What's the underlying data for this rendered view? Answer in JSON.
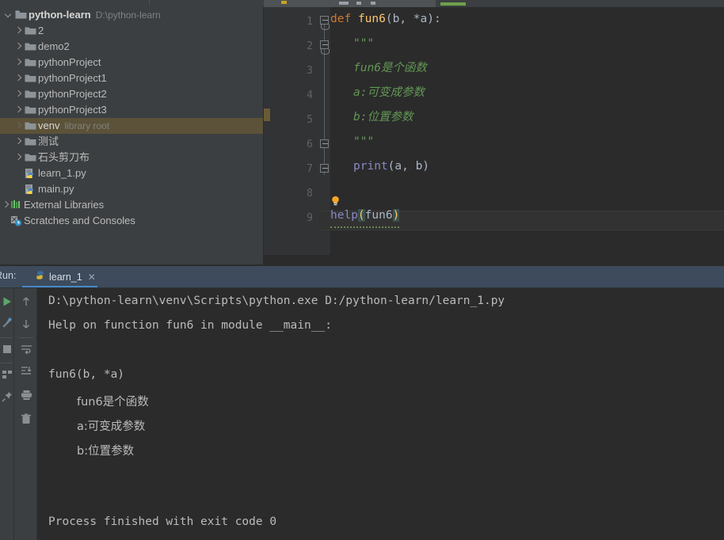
{
  "window": {
    "title": "python-learn"
  },
  "sidebar": {
    "root": {
      "label": "python-learn",
      "path": "D:\\python-learn"
    },
    "items": [
      {
        "label": "2",
        "type": "folder",
        "expandable": true
      },
      {
        "label": "demo2",
        "type": "folder",
        "expandable": true
      },
      {
        "label": "pythonProject",
        "type": "folder",
        "expandable": true
      },
      {
        "label": "pythonProject1",
        "type": "folder",
        "expandable": true
      },
      {
        "label": "pythonProject2",
        "type": "folder",
        "expandable": true
      },
      {
        "label": "pythonProject3",
        "type": "folder",
        "expandable": true
      },
      {
        "label": "venv",
        "type": "folder",
        "expandable": true,
        "badge": "library root",
        "selected": true
      },
      {
        "label": "测试",
        "type": "folder",
        "expandable": true
      },
      {
        "label": "石头剪刀布",
        "type": "folder",
        "expandable": true
      },
      {
        "label": "learn_1.py",
        "type": "python-file",
        "expandable": false
      },
      {
        "label": "main.py",
        "type": "python-file",
        "expandable": false
      }
    ],
    "external_libraries": "External Libraries",
    "scratches": "Scratches and Consoles"
  },
  "editor": {
    "line_numbers": [
      "1",
      "2",
      "3",
      "4",
      "5",
      "6",
      "7",
      "8",
      "9"
    ],
    "lines": [
      {
        "n": 1,
        "tokens": [
          {
            "t": "def",
            "c": "kw"
          },
          {
            "t": " ",
            "c": "punc"
          },
          {
            "t": "fun6",
            "c": "fn"
          },
          {
            "t": "(b, *a):",
            "c": "punc"
          }
        ]
      },
      {
        "n": 2,
        "tokens": [
          {
            "t": "    \"\"\"",
            "c": "doc"
          }
        ]
      },
      {
        "n": 3,
        "tokens": [
          {
            "t": "    fun6是个函数",
            "c": "doc"
          }
        ]
      },
      {
        "n": 4,
        "tokens": [
          {
            "t": "    a:可变成参数",
            "c": "doc"
          }
        ]
      },
      {
        "n": 5,
        "tokens": [
          {
            "t": "    b:位置参数",
            "c": "doc"
          }
        ]
      },
      {
        "n": 6,
        "tokens": [
          {
            "t": "    \"\"\"",
            "c": "doc"
          }
        ]
      },
      {
        "n": 7,
        "tokens": [
          {
            "t": "    ",
            "c": "punc"
          },
          {
            "t": "print",
            "c": "bi"
          },
          {
            "t": "(a, b)",
            "c": "punc"
          }
        ]
      },
      {
        "n": 8,
        "tokens": []
      },
      {
        "n": 9,
        "tokens": [
          {
            "t": "help",
            "c": "bi"
          },
          {
            "t": "(",
            "c": "brk"
          },
          {
            "t": "fun6",
            "c": "param"
          },
          {
            "t": ")",
            "c": "brk"
          }
        ]
      }
    ],
    "text": {
      "l1": "def fun6(b, *a):",
      "l2": "\"\"\"",
      "l3": "fun6是个函数",
      "l4": "a:可变成参数",
      "l5": "b:位置参数",
      "l6": "\"\"\"",
      "l7_kw": "print",
      "l7_args": "(a, b)",
      "l1_kw": "def",
      "l1_fn": "fun6",
      "l1_sig": "(b, *a):",
      "l9_fn": "help",
      "l9_open": "(",
      "l9_arg": "fun6",
      "l9_close": ")"
    }
  },
  "run_panel": {
    "label": "Run:",
    "tab_name": "learn_1",
    "tab_close": "✕",
    "console_lines": [
      "D:\\python-learn\\venv\\Scripts\\python.exe D:/python-learn/learn_1.py",
      "Help on function fun6 in module __main__:",
      "",
      "fun6(b, *a)",
      "    fun6是个函数",
      "    a:可变成参数",
      "    b:位置参数",
      "",
      "Process finished with exit code 0"
    ],
    "line1": "D:\\python-learn\\venv\\Scripts\\python.exe D:/python-learn/learn_1.py",
    "line2": "Help on function fun6 in module __main__:",
    "line3": "fun6(b, *a)",
    "line4": "fun6是个函数",
    "line5": "a:可变成参数",
    "line6": "b:位置参数",
    "line7": "Process finished with exit code 0"
  },
  "colors": {
    "background": "#2b2b2b",
    "panel": "#3c3f41",
    "accent": "#4a88c7",
    "run_header": "#3d4b5c",
    "selection": "#5b5239",
    "keyword": "#cc7832",
    "function": "#ffc66d",
    "docstring": "#629755",
    "builtin": "#8888c6",
    "text": "#a9b7c6"
  }
}
